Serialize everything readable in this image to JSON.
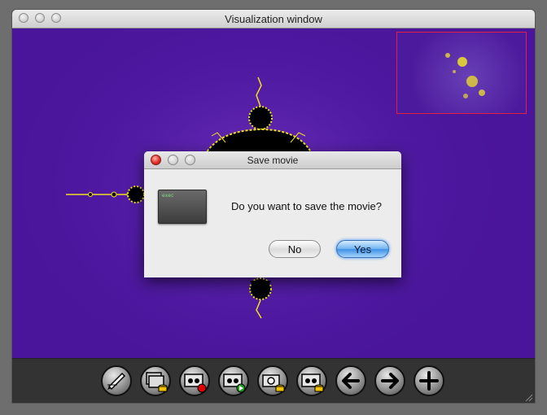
{
  "window": {
    "title": "Visualization window"
  },
  "dialog": {
    "title": "Save movie",
    "icon_text": "exec",
    "message": "Do you want to save the movie?",
    "no_label": "No",
    "yes_label": "Yes"
  },
  "toolbar": {
    "buttons": [
      "edit-pen-icon",
      "stack-windows-icon",
      "record-movie-icon",
      "play-movie-icon",
      "camera-save-icon",
      "save-movie-icon",
      "arrow-left-icon",
      "arrow-right-icon",
      "plus-icon"
    ]
  },
  "colors": {
    "canvas_purple": "#4f1aa2",
    "fractal_yellow": "#f0e020",
    "preview_border": "#e02040",
    "toolbar_bg": "#333333",
    "yes_button_blue": "#3d90e4"
  }
}
